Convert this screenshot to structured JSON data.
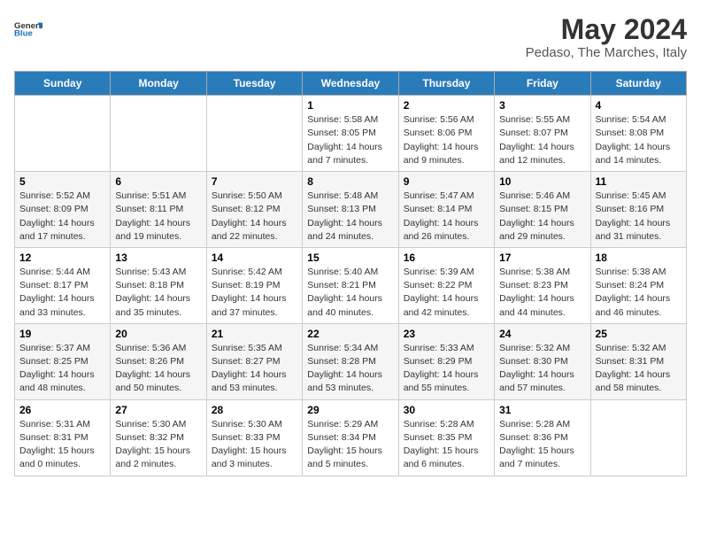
{
  "header": {
    "logo_general": "General",
    "logo_blue": "Blue",
    "month": "May 2024",
    "location": "Pedaso, The Marches, Italy"
  },
  "days_of_week": [
    "Sunday",
    "Monday",
    "Tuesday",
    "Wednesday",
    "Thursday",
    "Friday",
    "Saturday"
  ],
  "weeks": [
    [
      {
        "day": "",
        "info": ""
      },
      {
        "day": "",
        "info": ""
      },
      {
        "day": "",
        "info": ""
      },
      {
        "day": "1",
        "info": "Sunrise: 5:58 AM\nSunset: 8:05 PM\nDaylight: 14 hours\nand 7 minutes."
      },
      {
        "day": "2",
        "info": "Sunrise: 5:56 AM\nSunset: 8:06 PM\nDaylight: 14 hours\nand 9 minutes."
      },
      {
        "day": "3",
        "info": "Sunrise: 5:55 AM\nSunset: 8:07 PM\nDaylight: 14 hours\nand 12 minutes."
      },
      {
        "day": "4",
        "info": "Sunrise: 5:54 AM\nSunset: 8:08 PM\nDaylight: 14 hours\nand 14 minutes."
      }
    ],
    [
      {
        "day": "5",
        "info": "Sunrise: 5:52 AM\nSunset: 8:09 PM\nDaylight: 14 hours\nand 17 minutes."
      },
      {
        "day": "6",
        "info": "Sunrise: 5:51 AM\nSunset: 8:11 PM\nDaylight: 14 hours\nand 19 minutes."
      },
      {
        "day": "7",
        "info": "Sunrise: 5:50 AM\nSunset: 8:12 PM\nDaylight: 14 hours\nand 22 minutes."
      },
      {
        "day": "8",
        "info": "Sunrise: 5:48 AM\nSunset: 8:13 PM\nDaylight: 14 hours\nand 24 minutes."
      },
      {
        "day": "9",
        "info": "Sunrise: 5:47 AM\nSunset: 8:14 PM\nDaylight: 14 hours\nand 26 minutes."
      },
      {
        "day": "10",
        "info": "Sunrise: 5:46 AM\nSunset: 8:15 PM\nDaylight: 14 hours\nand 29 minutes."
      },
      {
        "day": "11",
        "info": "Sunrise: 5:45 AM\nSunset: 8:16 PM\nDaylight: 14 hours\nand 31 minutes."
      }
    ],
    [
      {
        "day": "12",
        "info": "Sunrise: 5:44 AM\nSunset: 8:17 PM\nDaylight: 14 hours\nand 33 minutes."
      },
      {
        "day": "13",
        "info": "Sunrise: 5:43 AM\nSunset: 8:18 PM\nDaylight: 14 hours\nand 35 minutes."
      },
      {
        "day": "14",
        "info": "Sunrise: 5:42 AM\nSunset: 8:19 PM\nDaylight: 14 hours\nand 37 minutes."
      },
      {
        "day": "15",
        "info": "Sunrise: 5:40 AM\nSunset: 8:21 PM\nDaylight: 14 hours\nand 40 minutes."
      },
      {
        "day": "16",
        "info": "Sunrise: 5:39 AM\nSunset: 8:22 PM\nDaylight: 14 hours\nand 42 minutes."
      },
      {
        "day": "17",
        "info": "Sunrise: 5:38 AM\nSunset: 8:23 PM\nDaylight: 14 hours\nand 44 minutes."
      },
      {
        "day": "18",
        "info": "Sunrise: 5:38 AM\nSunset: 8:24 PM\nDaylight: 14 hours\nand 46 minutes."
      }
    ],
    [
      {
        "day": "19",
        "info": "Sunrise: 5:37 AM\nSunset: 8:25 PM\nDaylight: 14 hours\nand 48 minutes."
      },
      {
        "day": "20",
        "info": "Sunrise: 5:36 AM\nSunset: 8:26 PM\nDaylight: 14 hours\nand 50 minutes."
      },
      {
        "day": "21",
        "info": "Sunrise: 5:35 AM\nSunset: 8:27 PM\nDaylight: 14 hours\nand 53 minutes."
      },
      {
        "day": "22",
        "info": "Sunrise: 5:34 AM\nSunset: 8:28 PM\nDaylight: 14 hours\nand 53 minutes."
      },
      {
        "day": "23",
        "info": "Sunrise: 5:33 AM\nSunset: 8:29 PM\nDaylight: 14 hours\nand 55 minutes."
      },
      {
        "day": "24",
        "info": "Sunrise: 5:32 AM\nSunset: 8:30 PM\nDaylight: 14 hours\nand 57 minutes."
      },
      {
        "day": "25",
        "info": "Sunrise: 5:32 AM\nSunset: 8:31 PM\nDaylight: 14 hours\nand 58 minutes."
      }
    ],
    [
      {
        "day": "26",
        "info": "Sunrise: 5:31 AM\nSunset: 8:31 PM\nDaylight: 15 hours\nand 0 minutes."
      },
      {
        "day": "27",
        "info": "Sunrise: 5:30 AM\nSunset: 8:32 PM\nDaylight: 15 hours\nand 2 minutes."
      },
      {
        "day": "28",
        "info": "Sunrise: 5:30 AM\nSunset: 8:33 PM\nDaylight: 15 hours\nand 3 minutes."
      },
      {
        "day": "29",
        "info": "Sunrise: 5:29 AM\nSunset: 8:34 PM\nDaylight: 15 hours\nand 5 minutes."
      },
      {
        "day": "30",
        "info": "Sunrise: 5:28 AM\nSunset: 8:35 PM\nDaylight: 15 hours\nand 6 minutes."
      },
      {
        "day": "31",
        "info": "Sunrise: 5:28 AM\nSunset: 8:36 PM\nDaylight: 15 hours\nand 7 minutes."
      },
      {
        "day": "",
        "info": ""
      }
    ]
  ]
}
